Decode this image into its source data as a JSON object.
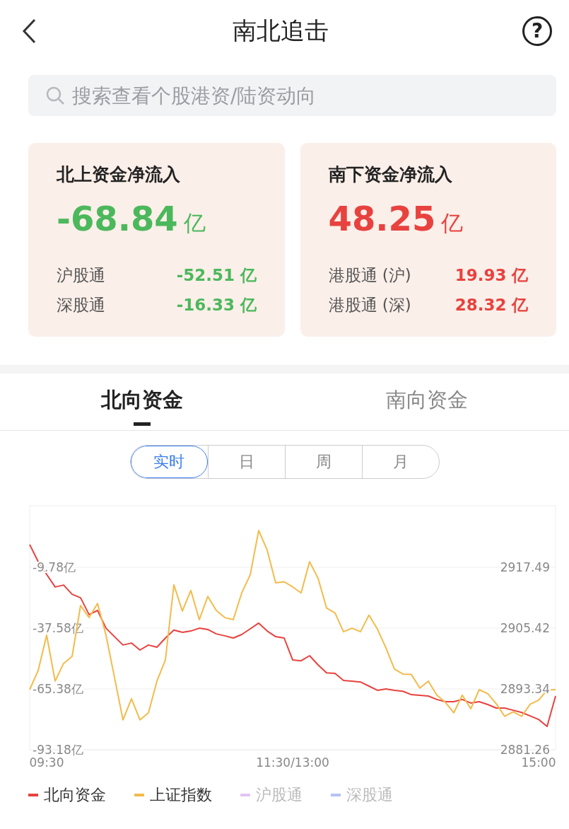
{
  "header": {
    "title": "南北追击",
    "help": "?"
  },
  "search": {
    "placeholder": "搜索查看个股港资/陆资动向"
  },
  "cards": [
    {
      "title": "北上资金净流入",
      "total": "-68.84",
      "unit": "亿",
      "color": "#4cb85c",
      "rows": [
        {
          "label": "沪股通",
          "value": "-52.51 亿"
        },
        {
          "label": "深股通",
          "value": "-16.33 亿"
        }
      ]
    },
    {
      "title": "南下资金净流入",
      "total": "48.25",
      "unit": "亿",
      "color": "#e8423f",
      "rows": [
        {
          "label": "港股通 (沪)",
          "value": "19.93 亿"
        },
        {
          "label": "港股通 (深)",
          "value": "28.32 亿"
        }
      ]
    }
  ],
  "tabs": [
    {
      "label": "北向资金",
      "selected": true
    },
    {
      "label": "南向资金",
      "selected": false
    }
  ],
  "periods": [
    {
      "label": "实时",
      "selected": true
    },
    {
      "label": "日",
      "selected": false
    },
    {
      "label": "周",
      "selected": false
    },
    {
      "label": "月",
      "selected": false
    }
  ],
  "chart": {
    "chart_data": {
      "type": "line",
      "grid": true,
      "categories": [
        null,
        null,
        "09:30",
        null,
        null,
        null,
        null,
        null,
        null,
        null,
        null,
        null,
        null,
        null,
        null,
        null,
        null,
        null,
        null,
        null,
        null,
        null,
        null,
        null,
        null,
        null,
        null,
        null,
        null,
        null,
        null,
        "11:30/13:00",
        null,
        null,
        null,
        null,
        null,
        null,
        null,
        null,
        null,
        null,
        null,
        null,
        null,
        null,
        null,
        null,
        null,
        null,
        null,
        null,
        null,
        null,
        null,
        null,
        null,
        null,
        null,
        null,
        "15:00",
        null,
        null
      ],
      "ylim": [
        -93.18,
        18.34
      ],
      "yticks": [
        {
          "value": -9.78,
          "label": "-9.78亿"
        },
        {
          "value": -37.58,
          "label": "-37.58亿"
        },
        {
          "value": -65.38,
          "label": "-65.38亿"
        },
        {
          "value": -93.18,
          "label": "-93.18亿"
        }
      ],
      "series": [
        {
          "color": "#e8423f",
          "values": [
            0.6,
            -7.2,
            -13.0,
            -18.8,
            -17.9,
            -22.1,
            -23.7,
            -31.4,
            -29.5,
            -37.6,
            -41.5,
            -45.3,
            -44.4,
            -47.6,
            -45.3,
            -46.3,
            -42.1,
            -38.5,
            -39.5,
            -38.9,
            -37.6,
            -38.2,
            -40.2,
            -41.1,
            -42.1,
            -40.5,
            -37.9,
            -35.3,
            -38.9,
            -41.5,
            -42.1,
            -52.1,
            -52.5,
            -50.2,
            -54.4,
            -58.0,
            -58.3,
            -61.5,
            -61.8,
            -62.2,
            -64.1,
            -66.0,
            -65.4,
            -66.0,
            -66.4,
            -68.0,
            -68.3,
            -68.6,
            -70.2,
            -71.2,
            -71.2,
            -70.2,
            -71.8,
            -71.2,
            -72.5,
            -74.1,
            -74.1,
            -75.1,
            -76.1,
            -77.7,
            -79.3,
            -82.5,
            -68.6
          ]
        }
      ]
    },
    "overlay": {
      "chart_data": {
        "type": "line",
        "ylim": [
          2881.26,
          2929.7
        ],
        "yticks": [
          {
            "value": 2917.49,
            "label": "2917.49"
          },
          {
            "value": 2905.42,
            "label": "2905.42"
          },
          {
            "value": 2893.34,
            "label": "2893.34"
          },
          {
            "value": 2881.26,
            "label": "2881.26"
          }
        ],
        "series": [
          {
            "color": "#f2bb4b",
            "values": [
              2893.2,
              2897.0,
              2904.0,
              2894.9,
              2898.4,
              2899.8,
              2909.9,
              2907.5,
              2910.3,
              2904.0,
              2895.6,
              2887.2,
              2891.4,
              2887.2,
              2888.6,
              2894.9,
              2899.1,
              2914.0,
              2908.8,
              2912.9,
              2907.1,
              2911.7,
              2908.9,
              2907.5,
              2907.1,
              2912.4,
              2916.0,
              2924.8,
              2920.9,
              2914.4,
              2914.6,
              2913.6,
              2912.4,
              2918.6,
              2915.3,
              2909.4,
              2908.4,
              2904.7,
              2905.4,
              2904.7,
              2908.0,
              2905.2,
              2901.5,
              2897.3,
              2896.3,
              2896.2,
              2893.5,
              2894.9,
              2892.1,
              2890.7,
              2888.6,
              2892.1,
              2889.4,
              2893.2,
              2892.4,
              2890.4,
              2887.9,
              2888.8,
              2887.9,
              2890.3,
              2891.1,
              2893.1,
              2893.2
            ]
          }
        ]
      }
    }
  },
  "legend": [
    {
      "label": "北向资金",
      "color": "#e8423f",
      "selected": true
    },
    {
      "label": "上证指数",
      "color": "#f2bb4b",
      "selected": true
    },
    {
      "label": "沪股通",
      "color": "#e2c4f2",
      "selected": false
    },
    {
      "label": "深股通",
      "color": "#b3c3f2",
      "selected": false
    }
  ]
}
